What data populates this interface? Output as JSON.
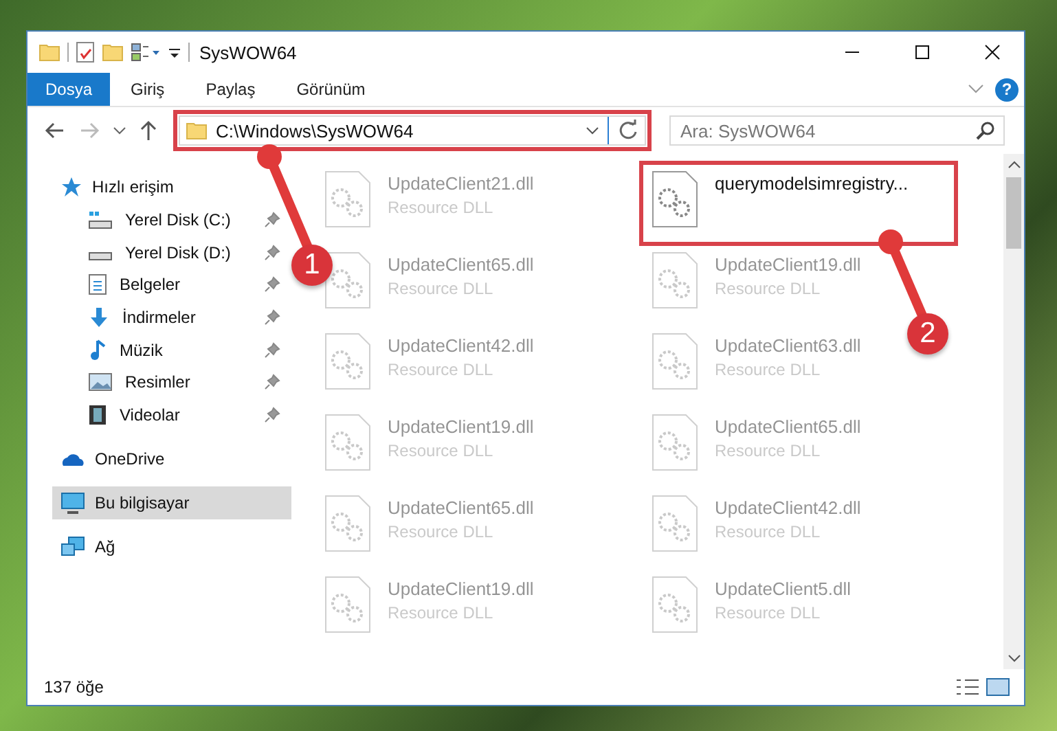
{
  "window": {
    "title": "SysWOW64"
  },
  "ribbon": {
    "tabs": [
      {
        "label": "Dosya",
        "selected": true
      },
      {
        "label": "Giriş",
        "selected": false
      },
      {
        "label": "Paylaş",
        "selected": false
      },
      {
        "label": "Görünüm",
        "selected": false
      }
    ],
    "help": "?"
  },
  "address": {
    "path": "C:\\Windows\\SysWOW64",
    "highlighted": true
  },
  "search": {
    "placeholder": "Ara: SysWOW64"
  },
  "sidebar": {
    "items": [
      {
        "label": "Hızlı erişim",
        "kind": "star",
        "selected": false,
        "children": [
          {
            "label": "Yerel Disk (C:)",
            "kind": "sysdrive",
            "pinned": true,
            "selected": false
          },
          {
            "label": "Yerel Disk (D:)",
            "kind": "drive",
            "pinned": true,
            "selected": false
          },
          {
            "label": "Belgeler",
            "kind": "docs",
            "pinned": true,
            "selected": false
          },
          {
            "label": "İndirmeler",
            "kind": "download",
            "pinned": true,
            "selected": false
          },
          {
            "label": "Müzik",
            "kind": "music",
            "pinned": true,
            "selected": false
          },
          {
            "label": "Resimler",
            "kind": "pictures",
            "pinned": true,
            "selected": false
          },
          {
            "label": "Videolar",
            "kind": "video",
            "pinned": true,
            "selected": false
          }
        ]
      },
      {
        "label": "OneDrive",
        "kind": "cloud",
        "selected": false
      },
      {
        "label": "Bu bilgisayar",
        "kind": "computer",
        "selected": true
      },
      {
        "label": "Ağ",
        "kind": "network",
        "selected": false
      }
    ]
  },
  "files": [
    {
      "name": "UpdateClient21.dll",
      "type": "Resource DLL",
      "faded": true,
      "highlighted": false
    },
    {
      "name": "querymodelsimregistry...",
      "faded": false,
      "highlighted": true
    },
    {
      "name": "UpdateClient65.dll",
      "type": "Resource DLL",
      "faded": true,
      "highlighted": false
    },
    {
      "name": "UpdateClient19.dll",
      "type": "Resource DLL",
      "faded": true,
      "highlighted": false
    },
    {
      "name": "UpdateClient42.dll",
      "type": "Resource DLL",
      "faded": true,
      "highlighted": false
    },
    {
      "name": "UpdateClient63.dll",
      "type": "Resource DLL",
      "faded": true,
      "highlighted": false
    },
    {
      "name": "UpdateClient19.dll",
      "type": "Resource DLL",
      "faded": true,
      "highlighted": false
    },
    {
      "name": "UpdateClient65.dll",
      "type": "Resource DLL",
      "faded": true,
      "highlighted": false
    },
    {
      "name": "UpdateClient65.dll",
      "type": "Resource DLL",
      "faded": true,
      "highlighted": false
    },
    {
      "name": "UpdateClient42.dll",
      "type": "Resource DLL",
      "faded": true,
      "highlighted": false
    },
    {
      "name": "UpdateClient19.dll",
      "type": "Resource DLL",
      "faded": true,
      "highlighted": false
    },
    {
      "name": "UpdateClient5.dll",
      "type": "Resource DLL",
      "faded": true,
      "highlighted": false
    }
  ],
  "callouts": [
    {
      "number": "1"
    },
    {
      "number": "2"
    }
  ],
  "status_bar": {
    "count": "137 öğe"
  }
}
